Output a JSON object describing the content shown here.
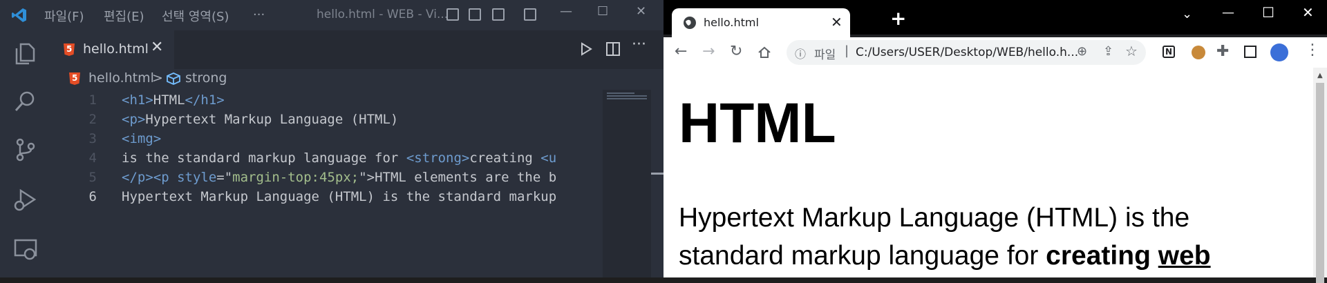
{
  "vscode": {
    "menu": [
      "파일(F)",
      "편집(E)",
      "선택 영역(S)",
      "..."
    ],
    "window_title": "hello.html - WEB - Vi...",
    "tab": {
      "label": "hello.html",
      "close": "✕"
    },
    "breadcrumb": {
      "file": "hello.html",
      "sep": ">",
      "symbol": "strong"
    },
    "editor": {
      "active_line": 6,
      "lines": [
        {
          "n": "1",
          "parts": [
            {
              "t": "tag",
              "v": "<h1>"
            },
            {
              "t": "txt",
              "v": "HTML"
            },
            {
              "t": "tag",
              "v": "</h1>"
            }
          ]
        },
        {
          "n": "2",
          "parts": [
            {
              "t": "tag",
              "v": "<p>"
            },
            {
              "t": "txt",
              "v": "Hypertext Markup Language (HTML)"
            }
          ]
        },
        {
          "n": "3",
          "parts": [
            {
              "t": "tag",
              "v": "<img>"
            }
          ]
        },
        {
          "n": "4",
          "parts": [
            {
              "t": "txt",
              "v": "is the standard markup language for "
            },
            {
              "t": "tag",
              "v": "<strong>"
            },
            {
              "t": "txt",
              "v": "creating "
            },
            {
              "t": "tag",
              "v": "<u"
            }
          ]
        },
        {
          "n": "5",
          "parts": [
            {
              "t": "tag",
              "v": "</p><p "
            },
            {
              "t": "attr",
              "v": "style"
            },
            {
              "t": "txt",
              "v": "=\""
            },
            {
              "t": "str",
              "v": "margin-top:45px;"
            },
            {
              "t": "txt",
              "v": "\">HTML elements are the b"
            }
          ]
        },
        {
          "n": "6",
          "parts": [
            {
              "t": "txt",
              "v": "Hypertext Markup Language (HTML) is the standard markup"
            }
          ]
        }
      ]
    },
    "colors": {
      "bg": "#2b303b",
      "tag": "#6e9ccf",
      "string": "#a3be8c",
      "text": "#c5c8ce"
    }
  },
  "chrome": {
    "tab": {
      "label": "hello.html",
      "close": "✕"
    },
    "new_tab": "+",
    "omnibox": {
      "scheme_label": "파일",
      "url": "C:/Users/USER/Desktop/WEB/hello.h..."
    },
    "page": {
      "h1": "HTML",
      "para_plain": "Hypertext Markup Language (HTML)  is the standard markup language for ",
      "para_strong": "creating",
      "para_strong_u": "web"
    }
  }
}
